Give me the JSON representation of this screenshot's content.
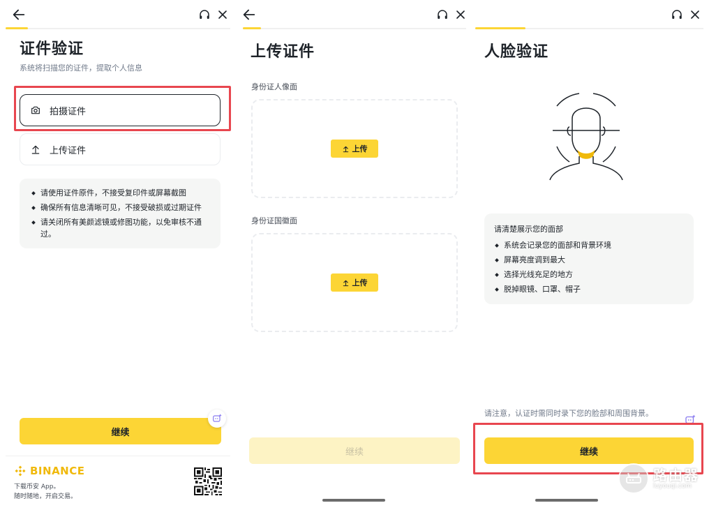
{
  "panels": [
    {
      "title": "证件验证",
      "subtitle": "系统将扫描您的证件，提取个人信息",
      "options": [
        {
          "label": "拍摄证件",
          "icon": "camera-icon",
          "selected": true
        },
        {
          "label": "上传证件",
          "icon": "upload-icon",
          "selected": false
        }
      ],
      "tips": [
        "请使用证件原件，不接受复印件或屏幕截图",
        "确保所有信息清晰可见，不接受破损或过期证件",
        "请关闭所有美颜滤镜或修图功能，以免审核不通过。"
      ],
      "continue_label": "继续",
      "progress": 0.1,
      "footer": {
        "brand": "BINANCE",
        "line1": "下载币安 App。",
        "line2": "随时随地，开启交易。"
      }
    },
    {
      "title": "上传证件",
      "front_label": "身份证人像面",
      "back_label": "身份证国徽面",
      "upload_label": "上传",
      "continue_label": "继续",
      "progress": 0.08
    },
    {
      "title": "人脸验证",
      "tips_title": "请清楚展示您的面部",
      "tips": [
        "系统会记录您的面部和背景环境",
        "屏幕亮度调到最大",
        "选择光线充足的地方",
        "脱掉眼镜、口罩、帽子"
      ],
      "note": "请注意，认证时需同时录下您的脸部和周围背景。",
      "continue_label": "继续",
      "progress": 0.22
    }
  ],
  "watermark": {
    "big": "路由器",
    "small": "luyouqi.com"
  },
  "colors": {
    "accent": "#fcd535",
    "highlight": "#e8464f",
    "text": "#1e2329",
    "muted": "#707a8a"
  }
}
